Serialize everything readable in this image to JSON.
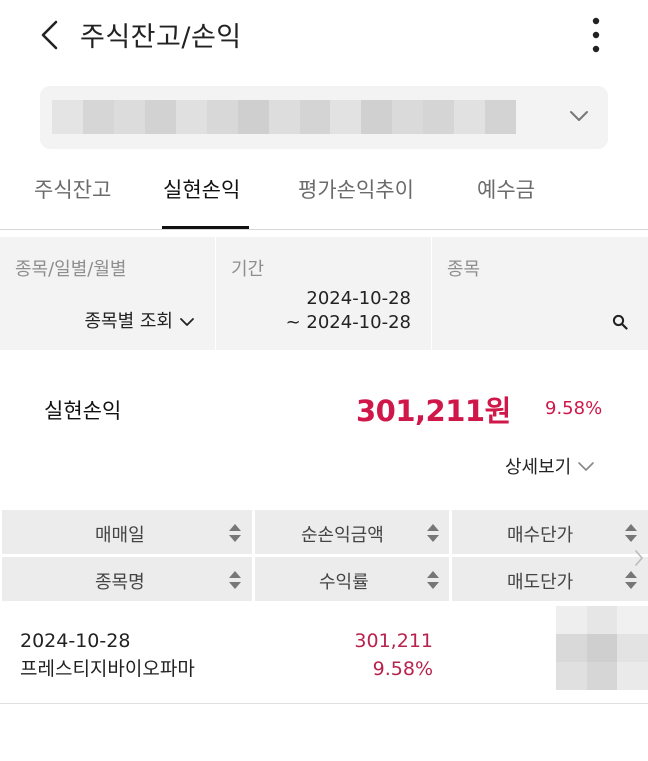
{
  "header": {
    "title": "주식잔고/손익",
    "back_icon": "chevron-left-icon",
    "more_icon": "more-vertical-icon"
  },
  "account": {
    "value_masked": true,
    "chevron_icon": "chevron-down-icon"
  },
  "tabs": [
    {
      "label": "주식잔고",
      "active": false
    },
    {
      "label": "실현손익",
      "active": true
    },
    {
      "label": "평가손익추이",
      "active": false
    },
    {
      "label": "예수금",
      "active": false
    }
  ],
  "filters": {
    "type": {
      "label": "종목/일별/월별",
      "value": "종목별 조회"
    },
    "period": {
      "label": "기간",
      "start": "2024-10-28",
      "end": "~ 2024-10-28"
    },
    "stock": {
      "label": "종목",
      "icon": "search-icon"
    }
  },
  "summary": {
    "label": "실현손익",
    "amount": "301,211원",
    "rate": "9.58%",
    "detail_label": "상세보기"
  },
  "table": {
    "headers_row1": [
      "매매일",
      "순손익금액",
      "매수단가"
    ],
    "headers_row2": [
      "종목명",
      "수익률",
      "매도단가"
    ],
    "rows": [
      {
        "date": "2024-10-28",
        "name": "프레스티지바이오파마",
        "profit": "301,211",
        "rate": "9.58%",
        "prices_masked": true
      }
    ]
  },
  "colors": {
    "accent_red": "#d0174a",
    "panel_bg": "#f3f3f3",
    "table_header_bg": "#ececec"
  }
}
